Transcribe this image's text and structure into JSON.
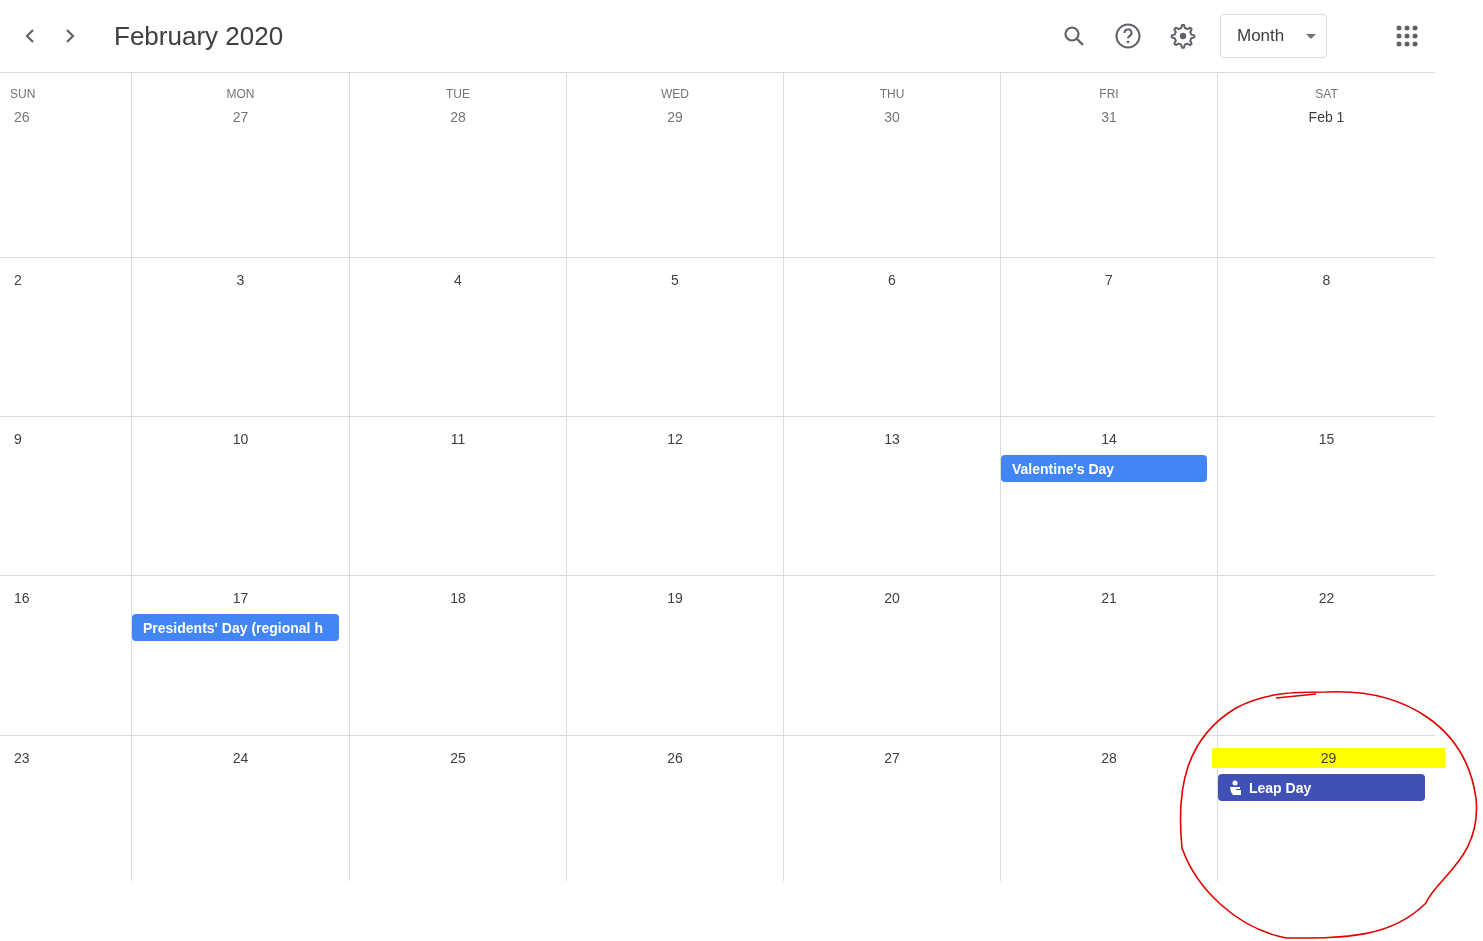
{
  "header": {
    "title": "February 2020",
    "view_button": "Month"
  },
  "weekdays": [
    "SUN",
    "MON",
    "TUE",
    "WED",
    "THU",
    "FRI",
    "SAT"
  ],
  "weeks": [
    {
      "days": [
        {
          "label": "26",
          "in_month": false
        },
        {
          "label": "27",
          "in_month": false
        },
        {
          "label": "28",
          "in_month": false
        },
        {
          "label": "29",
          "in_month": false
        },
        {
          "label": "30",
          "in_month": false
        },
        {
          "label": "31",
          "in_month": false
        },
        {
          "label": "Feb 1",
          "in_month": true
        }
      ]
    },
    {
      "days": [
        {
          "label": "2",
          "in_month": true
        },
        {
          "label": "3",
          "in_month": true
        },
        {
          "label": "4",
          "in_month": true
        },
        {
          "label": "5",
          "in_month": true
        },
        {
          "label": "6",
          "in_month": true
        },
        {
          "label": "7",
          "in_month": true
        },
        {
          "label": "8",
          "in_month": true
        }
      ]
    },
    {
      "days": [
        {
          "label": "9",
          "in_month": true
        },
        {
          "label": "10",
          "in_month": true
        },
        {
          "label": "11",
          "in_month": true
        },
        {
          "label": "12",
          "in_month": true
        },
        {
          "label": "13",
          "in_month": true
        },
        {
          "label": "14",
          "in_month": true,
          "events": [
            {
              "title": "Valentine's Day",
              "kind": "plain",
              "color": "#4285f4"
            }
          ]
        },
        {
          "label": "15",
          "in_month": true
        }
      ]
    },
    {
      "days": [
        {
          "label": "16",
          "in_month": true
        },
        {
          "label": "17",
          "in_month": true,
          "events": [
            {
              "title": "Presidents' Day (regional h",
              "kind": "plain",
              "color": "#4285f4"
            }
          ]
        },
        {
          "label": "18",
          "in_month": true
        },
        {
          "label": "19",
          "in_month": true
        },
        {
          "label": "20",
          "in_month": true
        },
        {
          "label": "21",
          "in_month": true
        },
        {
          "label": "22",
          "in_month": true
        }
      ]
    },
    {
      "days": [
        {
          "label": "23",
          "in_month": true
        },
        {
          "label": "24",
          "in_month": true
        },
        {
          "label": "25",
          "in_month": true
        },
        {
          "label": "26",
          "in_month": true
        },
        {
          "label": "27",
          "in_month": true
        },
        {
          "label": "28",
          "in_month": true
        },
        {
          "label": "29",
          "in_month": true,
          "highlighted": true,
          "events": [
            {
              "title": "Leap Day",
              "kind": "icon",
              "color": "#3f51b5"
            }
          ]
        }
      ]
    }
  ]
}
